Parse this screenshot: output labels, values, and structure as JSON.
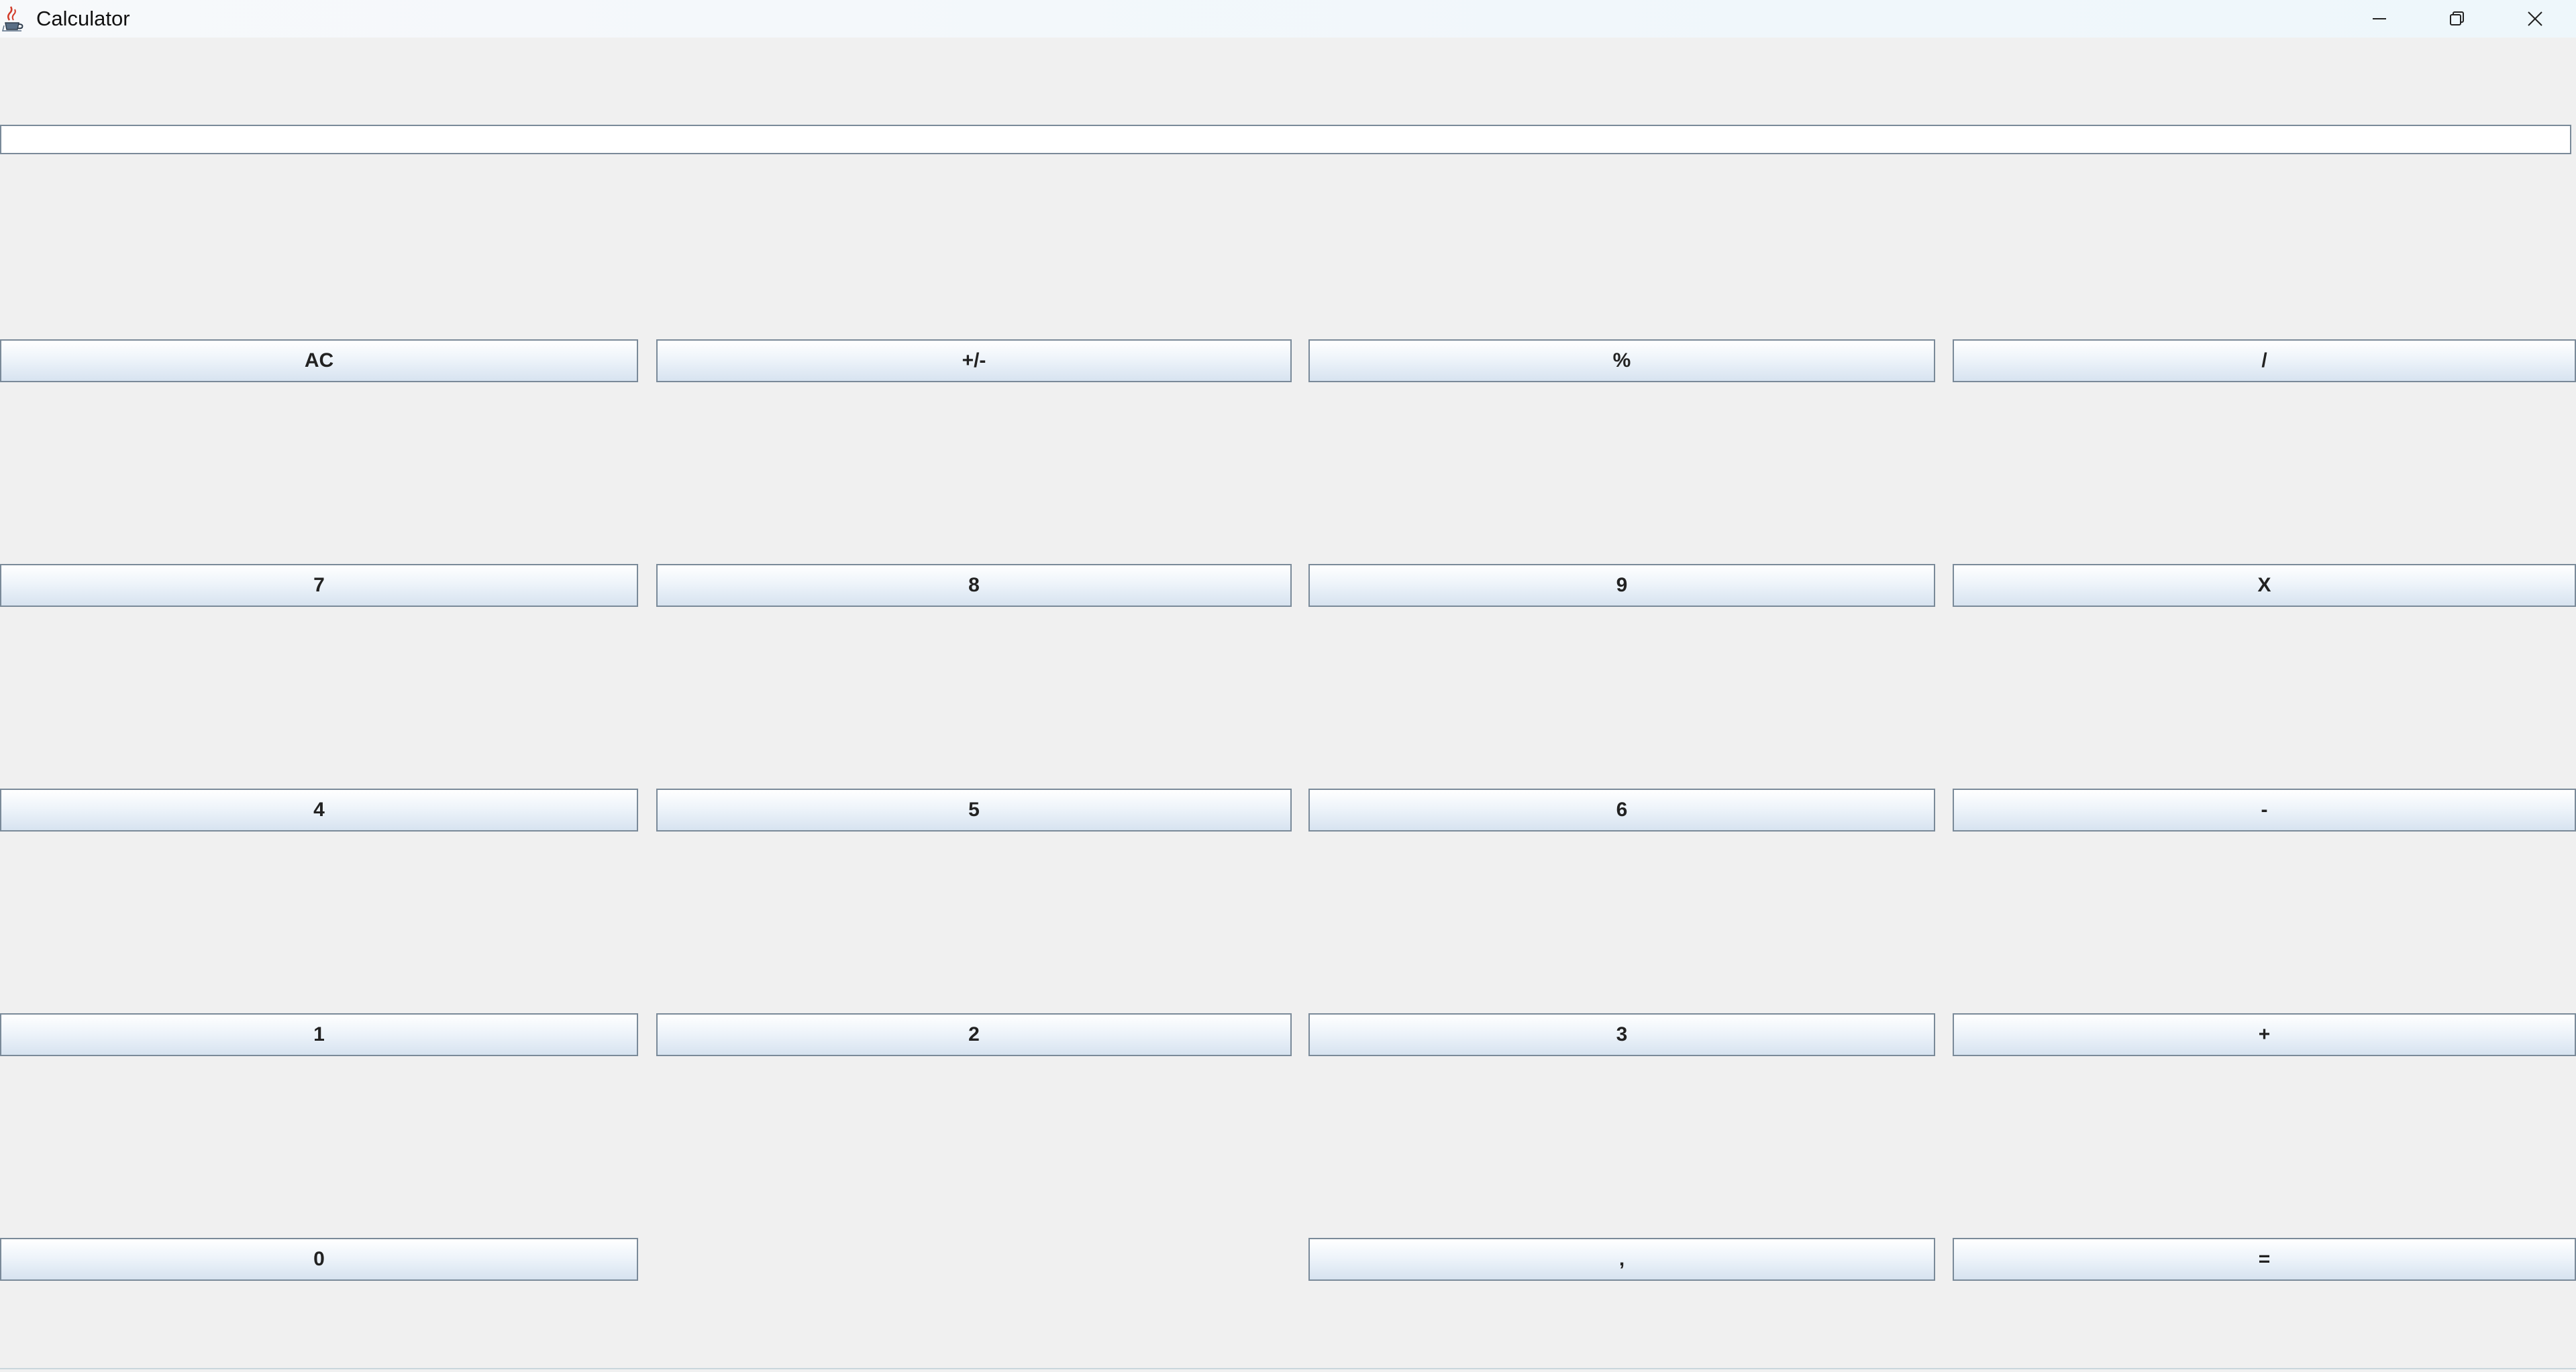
{
  "window": {
    "title": "Calculator",
    "icon": "java-cup-icon",
    "controls": {
      "minimize": "minimize-icon",
      "maximize": "restore-icon",
      "close": "close-icon"
    }
  },
  "display": {
    "value": ""
  },
  "keys": {
    "row1": [
      "AC",
      "+/-",
      "%",
      "/"
    ],
    "row2": [
      "7",
      "8",
      "9",
      "X"
    ],
    "row3": [
      "4",
      "5",
      "6",
      "-"
    ],
    "row4": [
      "1",
      "2",
      "3",
      "+"
    ],
    "row5": [
      "0",
      ",",
      "="
    ]
  },
  "colors": {
    "background": "#f0f0f0",
    "button_border": "#7a8a99",
    "button_gradient_top": "#ffffff",
    "button_gradient_bottom": "#d7e3f0"
  }
}
